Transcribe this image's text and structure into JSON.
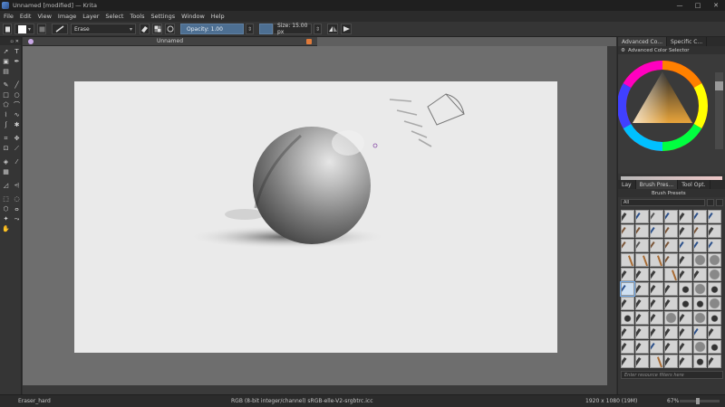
{
  "window": {
    "title": "Unnamed [modified] — Krita",
    "controls": [
      "—",
      "□",
      "✕"
    ]
  },
  "menu": [
    "File",
    "Edit",
    "View",
    "Image",
    "Layer",
    "Select",
    "Tools",
    "Settings",
    "Window",
    "Help"
  ],
  "toolbar": {
    "blend_mode": "Erase",
    "opacity_label": "Opacity:  1.00",
    "opacity_value": 1.0,
    "size_label": "Size:  15.00 px",
    "size_value": 15.0
  },
  "document": {
    "tab_title": "Unnamed"
  },
  "docker": {
    "top_tabs": [
      "Advanced Co...",
      "Specific C..."
    ],
    "color_selector_title": "Advanced Color Selector",
    "bottom_tabs": [
      "Lay",
      "Brush Pres...",
      "Tool Opt."
    ],
    "brush_presets_title": "Brush Presets",
    "filter_value": "All",
    "search_placeholder": "Enter resource filters here"
  },
  "status": {
    "tool": "Eraser_hard",
    "color_profile": "RGB (8-bit integer/channel)  sRGB-elle-V2-srgbtrc.icc",
    "image_size": "1920 x 1080 (19M)",
    "zoom": "67%"
  },
  "colors": {
    "accent": "#4d6f92",
    "canvas": "#eaeaea",
    "workspace": "#6e6e6e"
  }
}
